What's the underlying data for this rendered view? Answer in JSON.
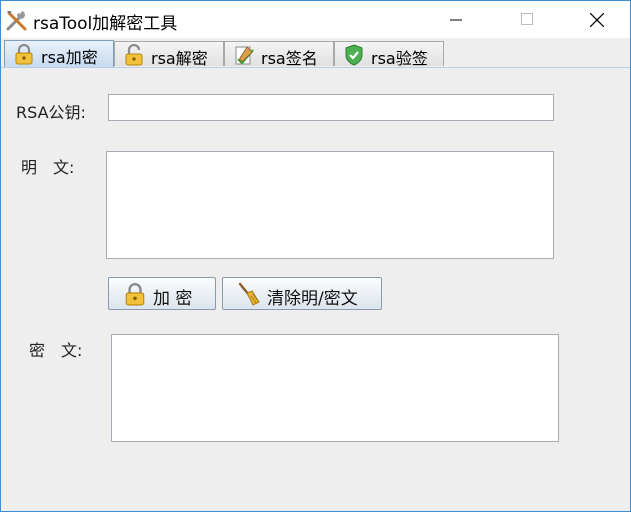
{
  "window": {
    "title": "rsaTool加解密工具"
  },
  "tabs": [
    {
      "label": "rsa加密",
      "icon": "lock-icon",
      "active": true
    },
    {
      "label": "rsa解密",
      "icon": "unlock-icon",
      "active": false
    },
    {
      "label": "rsa签名",
      "icon": "sign-icon",
      "active": false
    },
    {
      "label": "rsa验签",
      "icon": "shield-check-icon",
      "active": false
    }
  ],
  "form": {
    "public_key_label": "RSA公钥:",
    "public_key_value": "",
    "plaintext_label": "明　文:",
    "plaintext_value": "",
    "ciphertext_label": "密　文:",
    "ciphertext_value": ""
  },
  "buttons": {
    "encrypt_label": "加 密",
    "clear_label": "清除明/密文"
  },
  "colors": {
    "window_border": "#3c8fd6",
    "panel_bg": "#eeeeee",
    "active_tab": "#c7daf0"
  }
}
